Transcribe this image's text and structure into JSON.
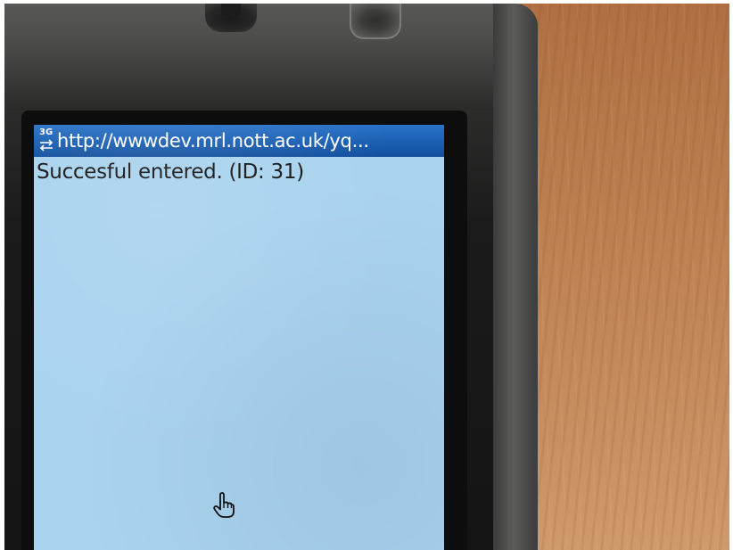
{
  "browser": {
    "network_indicator": "3G",
    "network_icon": "transfer-arrows-icon",
    "address_url": "http://wwwdev.mrl.nott.ac.uk/yq..."
  },
  "page": {
    "message": "Succesful entered. (ID: 31)"
  },
  "cursor": {
    "icon": "hand-pointer-icon"
  },
  "colors": {
    "title_bar": "#1b5fb2",
    "screen_background": "#a9d3ee",
    "message_text": "#141414",
    "phone_body": "#1b1b1b",
    "desk": "#bc7f50"
  }
}
